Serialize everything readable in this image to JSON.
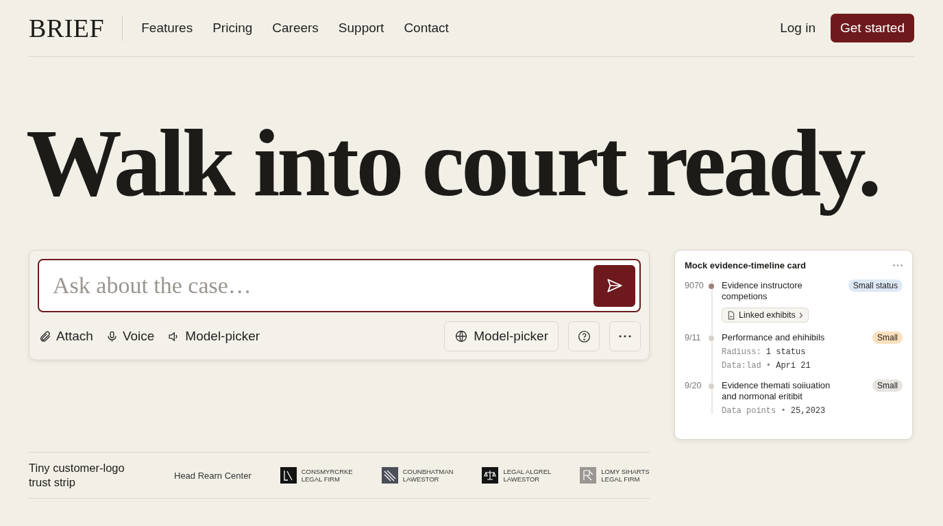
{
  "header": {
    "logo": "BRIEF",
    "nav": [
      {
        "label": "Features"
      },
      {
        "label": "Pricing"
      },
      {
        "label": "Careers"
      },
      {
        "label": "Support"
      },
      {
        "label": "Contact"
      }
    ],
    "login": "Log in",
    "cta": "Get started"
  },
  "hero": {
    "title": "Walk into court ready."
  },
  "composer": {
    "placeholder": "Ask about the case…",
    "tools": [
      {
        "kind": "attach",
        "label": "Attach"
      },
      {
        "kind": "voice",
        "label": "Voice"
      },
      {
        "kind": "speaker",
        "label": "Model-picker"
      }
    ],
    "model_button": "Model-picker"
  },
  "timeline_card": {
    "title": "Mock evidence-timeline card",
    "items": [
      {
        "date": "9070",
        "color": "#a08078",
        "title": "Evidence instructore competions",
        "badge": {
          "text": "Small status",
          "color": "#dde8f5"
        },
        "link": "Linked exhibits"
      },
      {
        "date": "9/11",
        "color": "#d6d2cb",
        "title": "Performance and ehihibils",
        "badge": {
          "text": "Small",
          "color": "#fbe0bd"
        },
        "meta": [
          {
            "label": "Radiuss:",
            "value": "1 status"
          },
          {
            "label": "Data:lad •",
            "value": "Apri 21"
          }
        ]
      },
      {
        "date": "9/20",
        "color": "#d6d2cb",
        "title": "Evidence themati soiiuation and normonal eritibit",
        "badge": {
          "text": "Small",
          "color": "#e6e4e1"
        },
        "meta": [
          {
            "label": "Data points •",
            "value": "25,2023"
          }
        ]
      }
    ]
  },
  "trust_strip": {
    "label": "Tiny customer-logo trust strip",
    "logos": [
      {
        "kind": "text",
        "lines": [
          "Head Rearn Center"
        ]
      },
      {
        "kind": "letters",
        "lines": [
          "CONSMYRCRKE",
          "LEGAL FIRM"
        ]
      },
      {
        "kind": "stripes",
        "lines": [
          "COUNBHATMAN",
          "LAWESTOR"
        ]
      },
      {
        "kind": "scales",
        "lines": [
          "LEGAL ALGREL",
          "LAWESTOR"
        ]
      },
      {
        "kind": "grey",
        "lines": [
          "LOMY SIHARTS",
          "LEGAL FIRM"
        ]
      }
    ]
  }
}
